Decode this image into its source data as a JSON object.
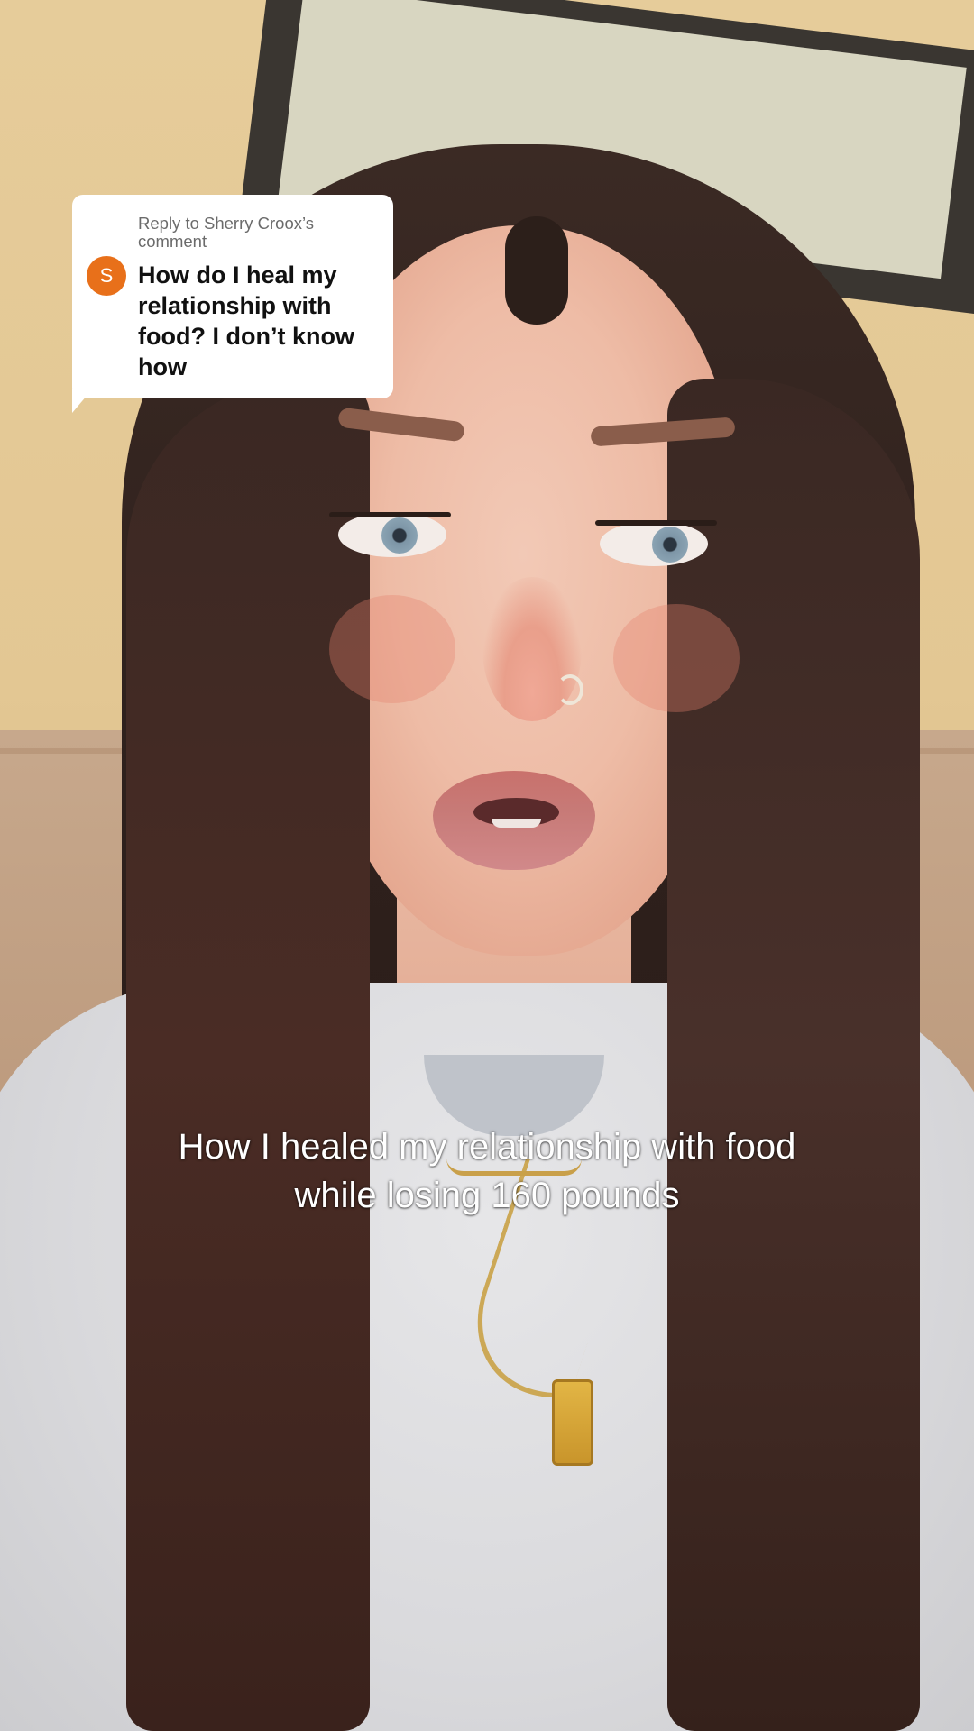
{
  "reply_sticker": {
    "avatar_initial": "S",
    "avatar_color": "#e8701a",
    "label": "Reply to Sherry Croox’s comment",
    "comment": "How do I heal my relationship with food? I don’t know how"
  },
  "caption": {
    "text": "How I healed my relationship with food\nwhile losing 160 pounds"
  }
}
